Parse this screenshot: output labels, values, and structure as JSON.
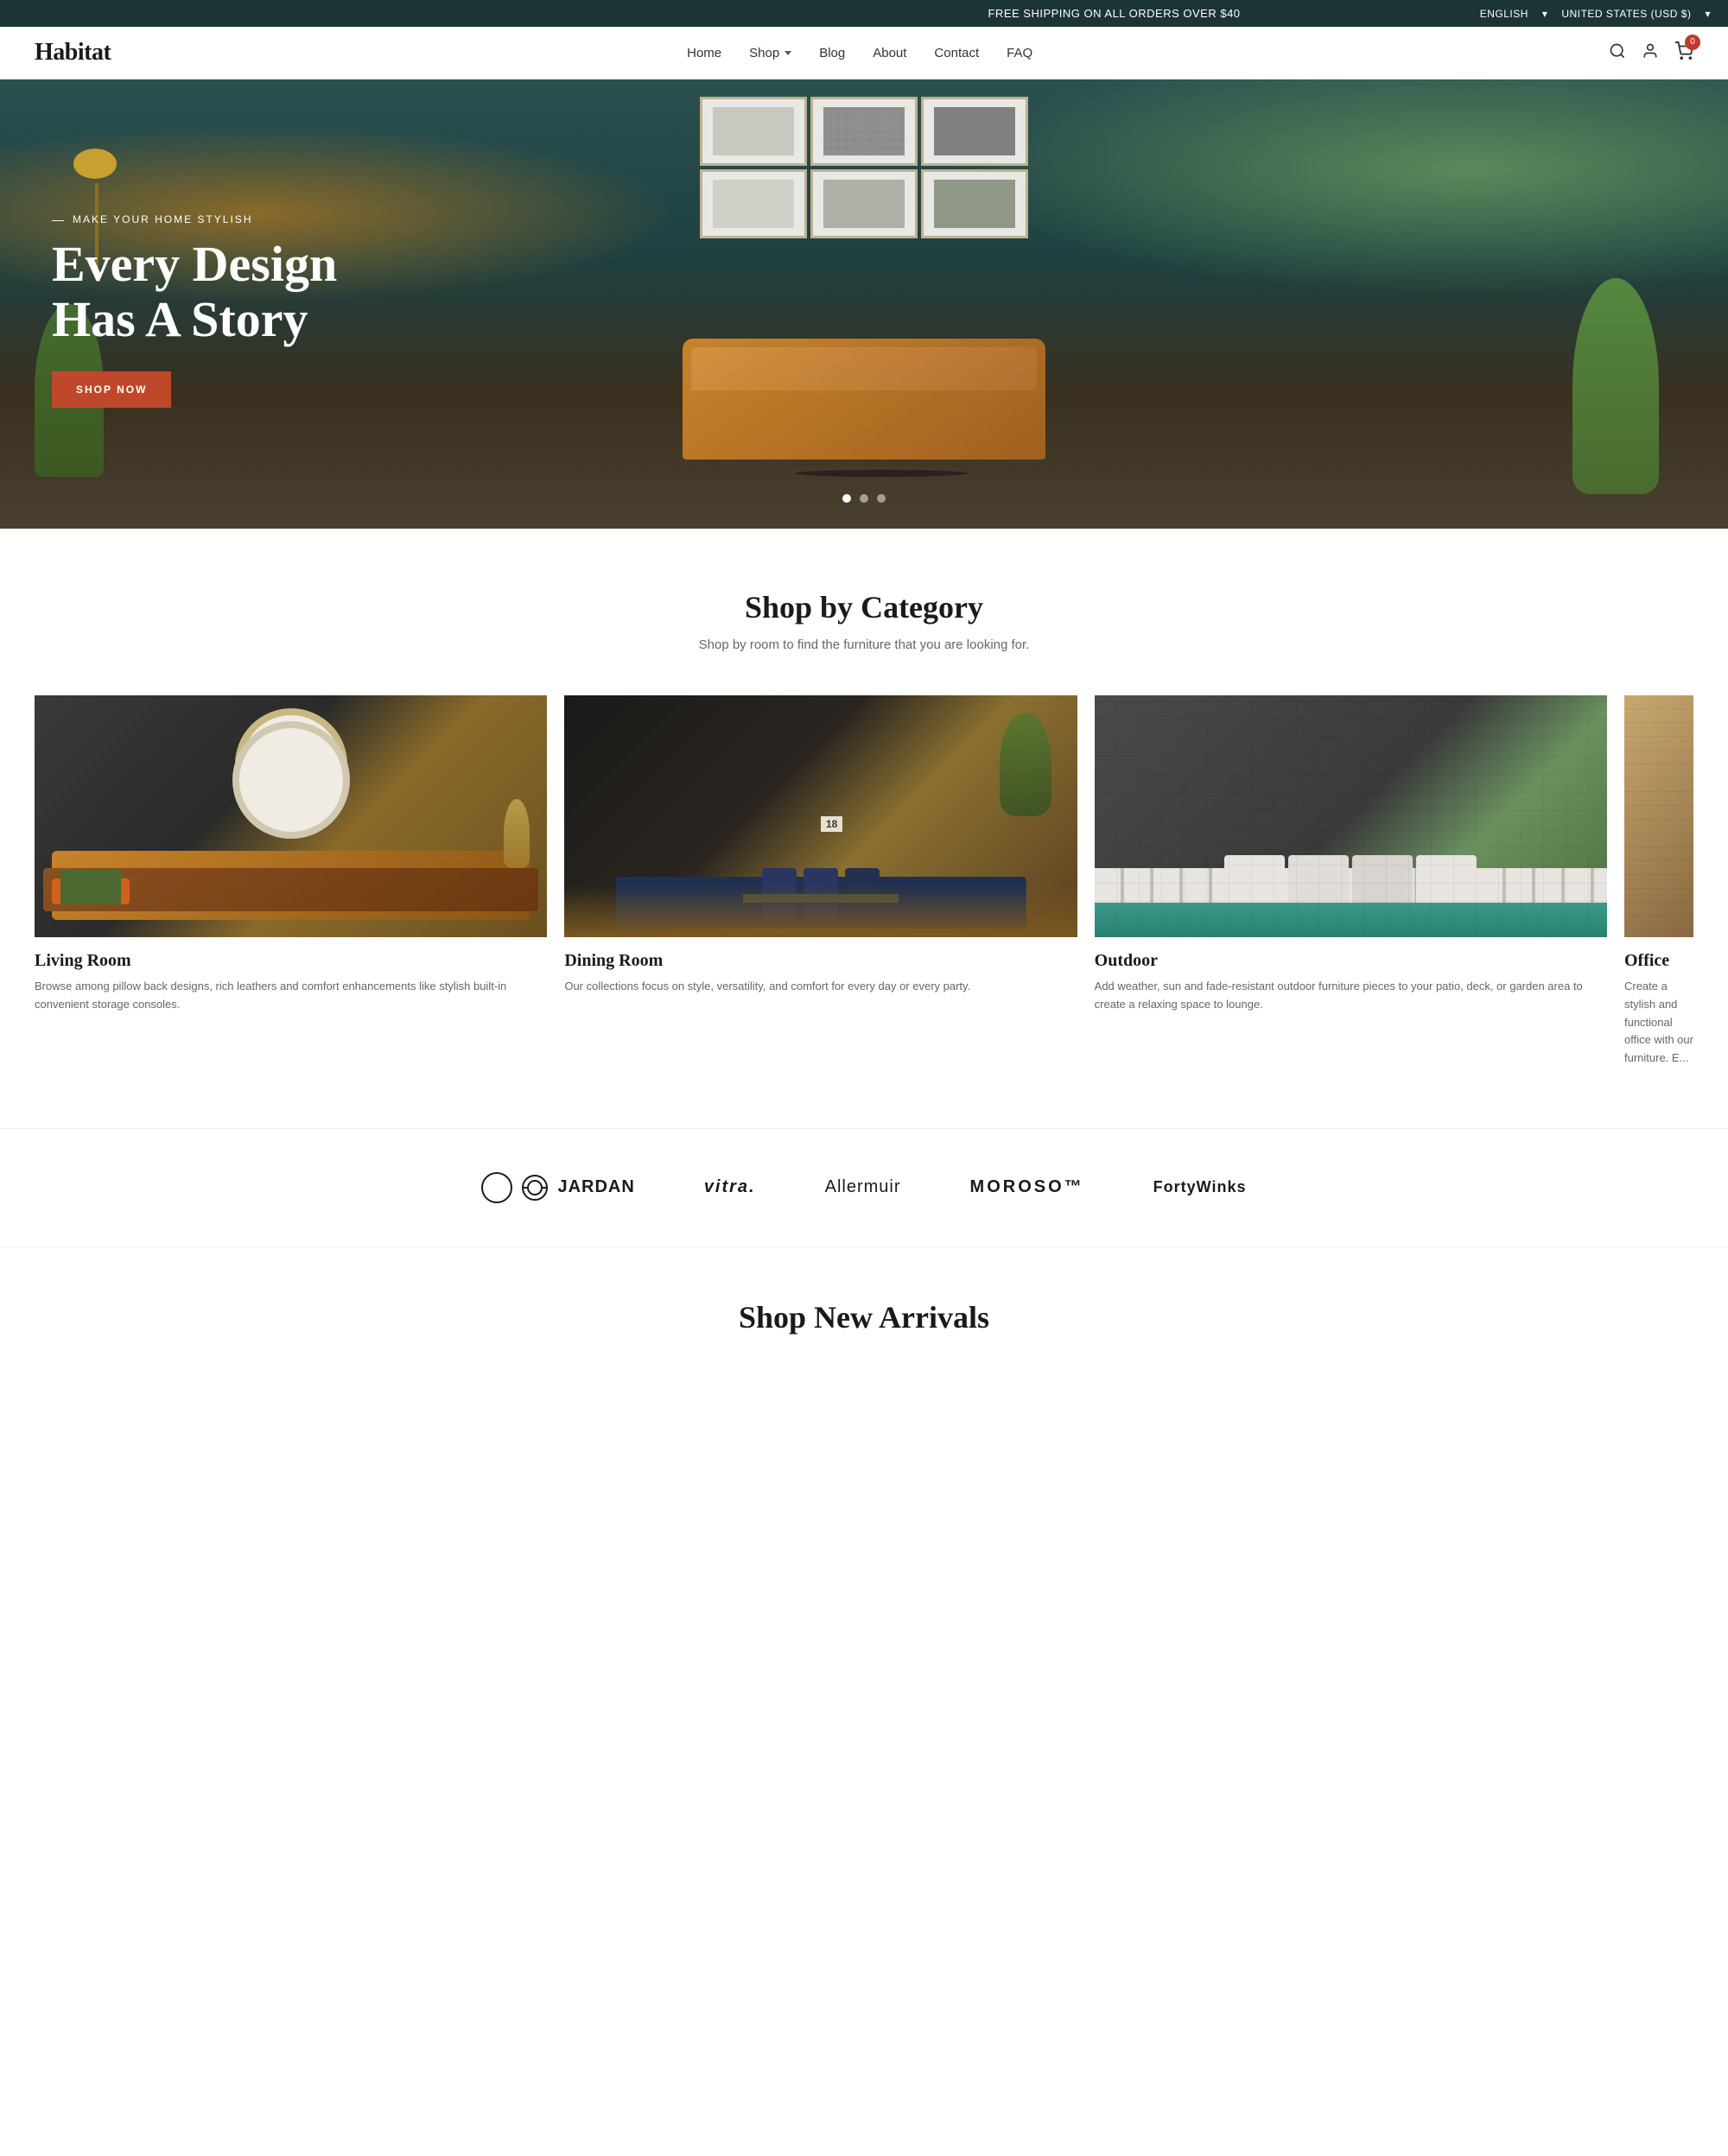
{
  "announcement": {
    "text": "FREE SHIPPING ON ALL ORDERS OVER $40",
    "language": "ENGLISH",
    "currency": "UNITED STATES (USD $)"
  },
  "header": {
    "logo": "Habitat",
    "nav": [
      {
        "label": "Home",
        "id": "home"
      },
      {
        "label": "Shop",
        "id": "shop",
        "hasDropdown": true
      },
      {
        "label": "Blog",
        "id": "blog"
      },
      {
        "label": "About",
        "id": "about"
      },
      {
        "label": "Contact",
        "id": "contact"
      },
      {
        "label": "FAQ",
        "id": "faq"
      }
    ],
    "cart_count": "0"
  },
  "hero": {
    "eyebrow": "MAKE YOUR HOME STYLISH",
    "title": "Every Design Has A Story",
    "cta": "SHOP NOW",
    "dots": [
      {
        "active": true
      },
      {
        "active": false
      },
      {
        "active": false
      }
    ]
  },
  "shop_by_category": {
    "title": "Shop by Category",
    "subtitle": "Shop by room to find the furniture that you are looking for.",
    "categories": [
      {
        "id": "living-room",
        "name": "Living Room",
        "description": "Browse among pillow back designs, rich leathers and comfort enhancements like stylish built-in convenient storage consoles."
      },
      {
        "id": "dining-room",
        "name": "Dining Room",
        "description": "Our collections focus on style, versatility, and comfort for every day or every party."
      },
      {
        "id": "outdoor",
        "name": "Outdoor",
        "description": "Add weather, sun and fade-resistant outdoor furniture pieces to your patio, deck, or garden area to create a relaxing space to lounge."
      },
      {
        "id": "office",
        "name": "Office",
        "description": "Create a stylish and functional office with our furniture. E..."
      }
    ]
  },
  "brands": {
    "items": [
      {
        "name": "JARDAN",
        "id": "jardan"
      },
      {
        "name": "vitra.",
        "id": "vitra"
      },
      {
        "name": "Allermuir",
        "id": "allermuir"
      },
      {
        "name": "MOROSO™",
        "id": "moroso"
      },
      {
        "name": "FortyWinks",
        "id": "fortywinks"
      }
    ]
  },
  "new_arrivals": {
    "title": "Shop New Arrivals"
  },
  "colors": {
    "primary_dark": "#1c3435",
    "cta_red": "#c0482a",
    "text_dark": "#1a1a1a",
    "text_muted": "#666666"
  }
}
